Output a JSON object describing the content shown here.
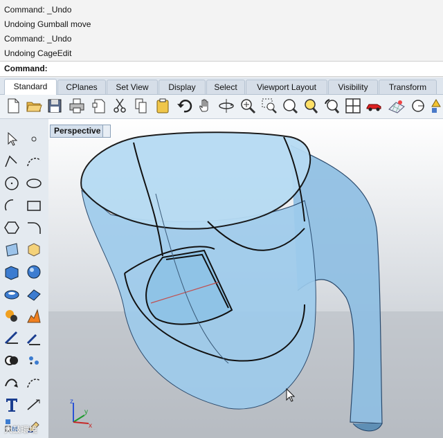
{
  "command_history": [
    "Command: _Undo",
    "Undoing Gumball move",
    "Command: _Undo",
    "Undoing CageEdit"
  ],
  "command_prompt": "Command:",
  "tabs": [
    "Standard",
    "CPlanes",
    "Set View",
    "Display",
    "Select",
    "Viewport Layout",
    "Visibility",
    "Transform"
  ],
  "active_tab": "Standard",
  "toolbar_icons": [
    "new-file-icon",
    "open-folder-icon",
    "save-icon",
    "print-icon",
    "import-icon",
    "cut-icon",
    "copy-icon",
    "paste-icon",
    "undo-icon",
    "pan-hand-icon",
    "rotate-view-icon",
    "zoom-icon",
    "zoom-window-icon",
    "zoom-extents-icon",
    "zoom-selected-icon",
    "undo-view-icon",
    "four-viewports-icon",
    "car-render-icon",
    "grid-icon",
    "circle-icon",
    "options-icon"
  ],
  "viewport": {
    "label": "Perspective"
  },
  "axes": {
    "x": "x",
    "y": "y",
    "z": "z"
  },
  "watermark": "大鼓環境"
}
